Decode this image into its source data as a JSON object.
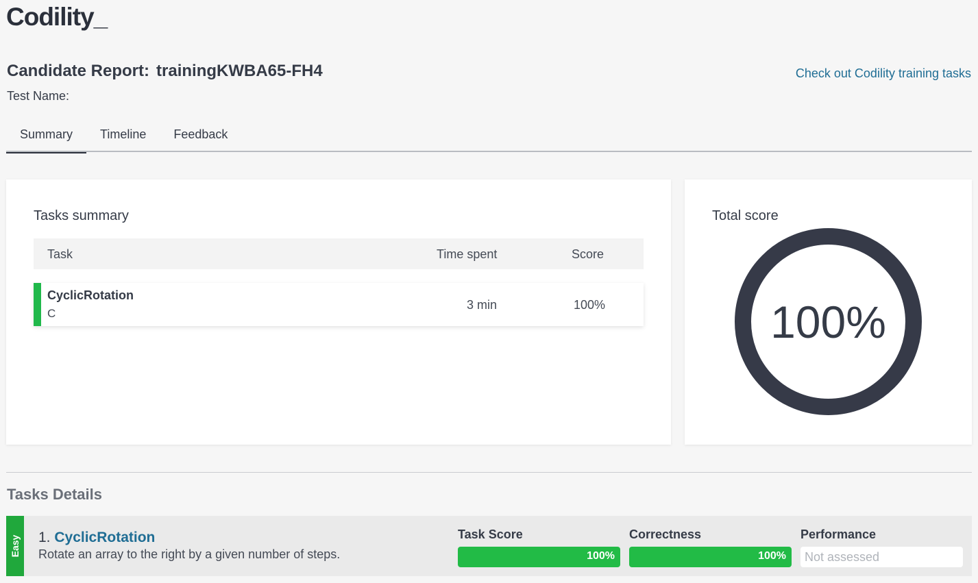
{
  "header": {
    "logo_text": "Codility_",
    "report_label": "Candidate Report:",
    "candidate_id": "trainingKWBA65-FH4",
    "test_name_label": "Test Name:",
    "training_link": "Check out Codility training tasks"
  },
  "tabs": [
    {
      "label": "Summary",
      "active": true
    },
    {
      "label": "Timeline",
      "active": false
    },
    {
      "label": "Feedback",
      "active": false
    }
  ],
  "tasks_summary": {
    "title": "Tasks summary",
    "columns": [
      "Task",
      "Time spent",
      "Score"
    ],
    "rows": [
      {
        "name": "CyclicRotation",
        "language": "C",
        "time": "3 min",
        "score": "100%",
        "status_color": "#20b84a"
      }
    ]
  },
  "total_score": {
    "title": "Total score",
    "value_text": "100%",
    "value": 100
  },
  "tasks_details": {
    "title": "Tasks Details",
    "items": [
      {
        "difficulty": "Easy",
        "number": "1.",
        "name": "CyclicRotation",
        "description": "Rotate an array to the right by a given number of steps.",
        "task_score_label": "Task Score",
        "task_score": "100%",
        "task_score_value": 100,
        "correctness_label": "Correctness",
        "correctness": "100%",
        "correctness_value": 100,
        "performance_label": "Performance",
        "performance": "Not assessed"
      }
    ]
  },
  "colors": {
    "accent_link": "#1f6d94",
    "success_green": "#22bb46",
    "ring": "#363a48"
  }
}
